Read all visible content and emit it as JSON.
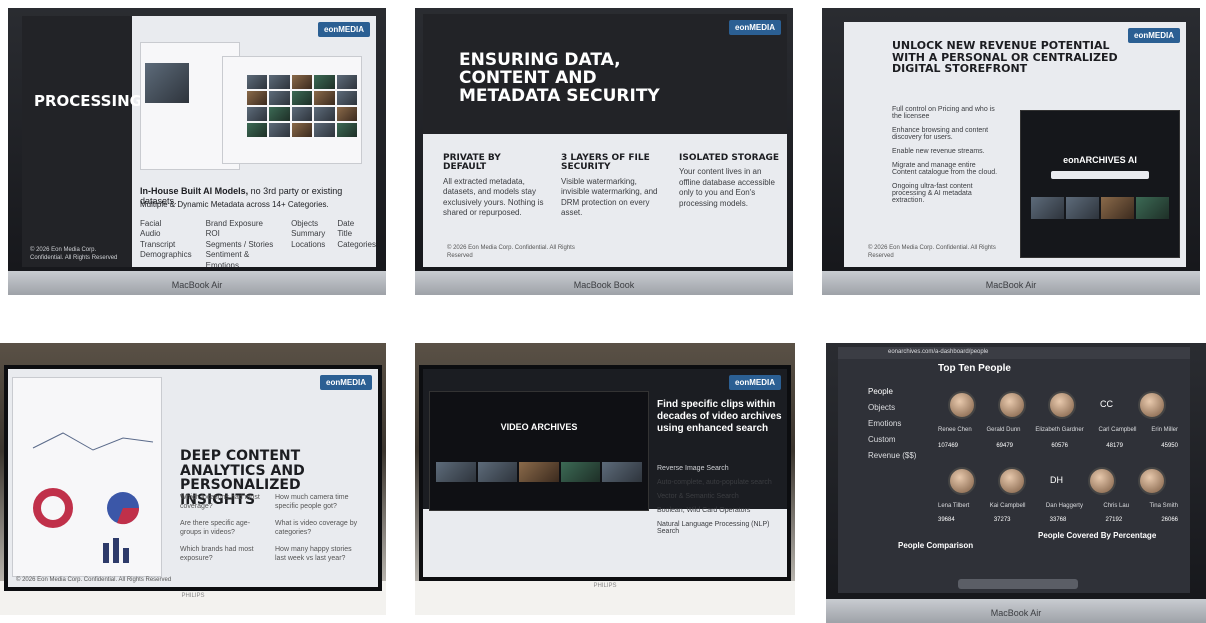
{
  "photos": [
    {
      "device": "MacBook Air",
      "slide_title": "PROCESSING",
      "logo": "eonMEDIA",
      "headline_bold": "In-House Built AI Models,",
      "headline_rest": " no 3rd party or existing datasets.",
      "subline": "Multiple & Dynamic Metadata across 14+ Categories.",
      "categories": [
        [
          "Facial",
          "Audio Transcript",
          "Demographics"
        ],
        [
          "Brand Exposure ROI",
          "Segments / Stories",
          "Sentiment & Emotions"
        ],
        [
          "Objects",
          "Summary",
          "Locations"
        ],
        [
          "Date",
          "Title",
          "Categories"
        ]
      ],
      "footer": "© 2026 Eon Media Corp. Confidential. All Rights Reserved"
    },
    {
      "device": "MacBook Book",
      "slide_title": "ENSURING DATA, CONTENT AND METADATA SECURITY",
      "logo": "eonMEDIA",
      "columns": [
        {
          "title": "PRIVATE BY DEFAULT",
          "text": "All extracted metadata, datasets, and models stay exclusively yours. Nothing is shared or repurposed."
        },
        {
          "title": "3 LAYERS OF FILE SECURITY",
          "text": "Visible watermarking, invisible watermarking, and DRM protection on every asset."
        },
        {
          "title": "ISOLATED STORAGE",
          "text": "Your content lives in an offline database accessible only to you and Eon's processing models."
        }
      ],
      "footer": "© 2026 Eon Media Corp. Confidential. All Rights Reserved"
    },
    {
      "device": "MacBook Air",
      "slide_title": "UNLOCK NEW REVENUE POTENTIAL WITH A PERSONAL OR CENTRALIZED DIGITAL STOREFRONT",
      "logo": "eonMEDIA",
      "bullets": [
        "Full control on Pricing and who is the licensee",
        "Enhance browsing and content discovery for users.",
        "Enable new revenue streams.",
        "Migrate and manage entire Content catalogue from the cloud.",
        "Ongoing ultra-fast content processing & AI metadata extraction."
      ],
      "store_name": "eonARCHIVES AI",
      "footer": "© 2026 Eon Media Corp. Confidential. All Rights Reserved"
    },
    {
      "device": "PHILIPS",
      "slide_title": "DEEP CONTENT ANALYTICS AND PERSONALIZED INSIGHTS",
      "logo": "eonMEDIA",
      "questions": [
        [
          "Which locations had most coverage?",
          "How much camera time specific people got?"
        ],
        [
          "Are there specific age-groups in videos?",
          "What is video coverage by categories?"
        ],
        [
          "Which brands had most exposure?",
          "How many happy stories last week vs last year?"
        ]
      ],
      "footer": "© 2026 Eon Media Corp. Confidential. All Rights Reserved"
    },
    {
      "device": "PHILIPS",
      "slide_title": "Find specific clips within decades of video archives using enhanced search",
      "logo": "eonMEDIA",
      "features": [
        "Reverse Image Search",
        "Auto-complete, auto-populate search",
        "Vector & Semantic Search",
        "Boolean, Wild Card Operators",
        "Natural Language Processing (NLP) Search"
      ],
      "screen_title": "VIDEO ARCHIVES"
    },
    {
      "device": "MacBook Air",
      "url": "eonarchives.com/a-dashboard/people",
      "section_title": "Top Ten People",
      "sidebar": [
        "People",
        "Objects",
        "Emotions",
        "Custom",
        "Revenue ($$)"
      ],
      "people_row1": [
        {
          "name": "Renee Chen",
          "metric": "Occurrences",
          "value": "107469"
        },
        {
          "name": "Gerald Dunn",
          "metric": "Occurrences",
          "value": "69479"
        },
        {
          "name": "Elizabeth Gardner",
          "metric": "Occurrences",
          "value": "60576"
        },
        {
          "name": "Carl Campbell",
          "initials": "CC",
          "metric": "Occurrences",
          "value": "48179"
        },
        {
          "name": "Erin Miller",
          "metric": "Occurrences",
          "value": "45950"
        }
      ],
      "people_row2": [
        {
          "name": "Lena Tilbert",
          "metric": "Occurrences",
          "value": "39684"
        },
        {
          "name": "Kai Campbell",
          "metric": "Occurrences",
          "value": "37273"
        },
        {
          "name": "Dan Haggerty",
          "initials": "DH",
          "metric": "Occurrences",
          "value": "33768"
        },
        {
          "name": "Chris Lau",
          "metric": "Occurrences",
          "value": "27192"
        },
        {
          "name": "Tina Smith",
          "metric": "Occurrences",
          "value": "26066"
        }
      ],
      "footer_left": "People Comparison",
      "footer_right": "People Covered By Percentage"
    }
  ]
}
